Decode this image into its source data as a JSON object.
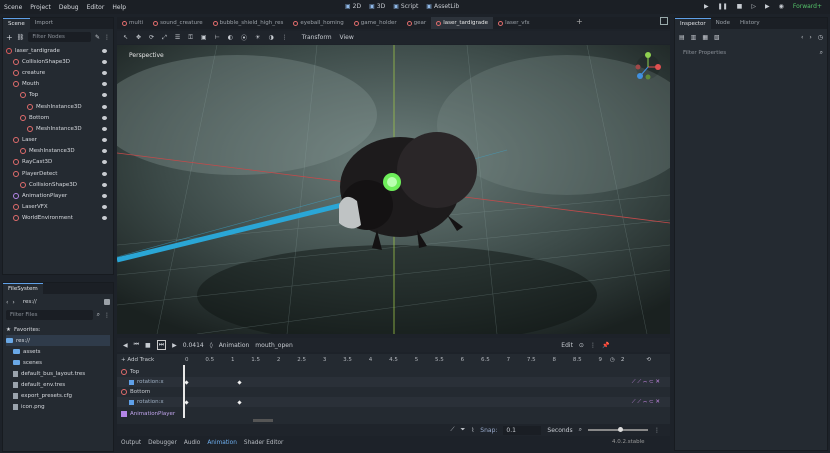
{
  "menu": [
    "Scene",
    "Project",
    "Debug",
    "Editor",
    "Help"
  ],
  "workspaces": [
    "2D",
    "3D",
    "Script",
    "AssetLib"
  ],
  "renderer": "Forward+",
  "doc_tabs": [
    "multi",
    "sound_creature",
    "bubble_shield_high_res",
    "eyeball_homing",
    "game_holder",
    "gear",
    "laser_tardigrade",
    "laser_vfx"
  ],
  "active_doc": "laser_tardigrade",
  "scene_dock": {
    "tabs": [
      "Scene",
      "Import"
    ],
    "filter_placeholder": "Filter Nodes",
    "nodes": [
      {
        "label": "laser_tardigrade",
        "indent": 0,
        "color": "#e05c5c"
      },
      {
        "label": "CollisionShape3D",
        "indent": 1,
        "color": "#e06c6c"
      },
      {
        "label": "creature",
        "indent": 1,
        "color": "#e06c6c"
      },
      {
        "label": "Mouth",
        "indent": 1,
        "color": "#e06c6c"
      },
      {
        "label": "Top",
        "indent": 2,
        "color": "#e06c6c"
      },
      {
        "label": "MeshInstance3D",
        "indent": 3,
        "color": "#e06c6c"
      },
      {
        "label": "Bottom",
        "indent": 2,
        "color": "#e06c6c"
      },
      {
        "label": "MeshInstance3D",
        "indent": 3,
        "color": "#e06c6c"
      },
      {
        "label": "Laser",
        "indent": 1,
        "color": "#e06c6c"
      },
      {
        "label": "MeshInstance3D",
        "indent": 2,
        "color": "#e06c6c"
      },
      {
        "label": "RayCast3D",
        "indent": 1,
        "color": "#e06c6c"
      },
      {
        "label": "PlayerDetect",
        "indent": 1,
        "color": "#e06c6c"
      },
      {
        "label": "CollisionShape3D",
        "indent": 2,
        "color": "#e06c6c"
      },
      {
        "label": "AnimationPlayer",
        "indent": 1,
        "color": "#b486e8"
      },
      {
        "label": "LaserVFX",
        "indent": 1,
        "color": "#e06c6c"
      },
      {
        "label": "WorldEnvironment",
        "indent": 1,
        "color": "#e06c6c"
      }
    ]
  },
  "filesystem": {
    "title": "FileSystem",
    "path": "res://",
    "filter_placeholder": "Filter Files",
    "favorites": "Favorites:",
    "items": [
      {
        "label": "res://",
        "type": "folder",
        "indent": 0
      },
      {
        "label": "assets",
        "type": "folder",
        "indent": 1
      },
      {
        "label": "scenes",
        "type": "folder",
        "indent": 1
      },
      {
        "label": "default_bus_layout.tres",
        "type": "file",
        "indent": 1
      },
      {
        "label": "default_env.tres",
        "type": "file",
        "indent": 1
      },
      {
        "label": "export_presets.cfg",
        "type": "file",
        "indent": 1
      },
      {
        "label": "icon.png",
        "type": "file",
        "indent": 1
      }
    ]
  },
  "viewport": {
    "label": "Perspective",
    "menus": [
      "Transform",
      "View"
    ]
  },
  "inspector": {
    "tabs": [
      "Inspector",
      "Node",
      "History"
    ],
    "filter_placeholder": "Filter Properties"
  },
  "animation": {
    "time": "0.0414",
    "label": "Animation",
    "name": "mouth_open",
    "edit": "Edit",
    "add_track": "Add Track",
    "ticks": [
      "0",
      "0.5",
      "1",
      "1.5",
      "2",
      "2.5",
      "3",
      "3.5",
      "4",
      "4.5",
      "5",
      "5.5",
      "6",
      "6.5",
      "7",
      "7.5",
      "8",
      "8.5",
      "9"
    ],
    "zoom": "2",
    "tracks": [
      {
        "group": "Top",
        "prop": "rotation:x"
      },
      {
        "group": "Bottom",
        "prop": "rotation:x"
      }
    ],
    "footer_group": "AnimationPlayer",
    "snap_label": "Snap:",
    "snap_value": "0.1",
    "snap_unit": "Seconds"
  },
  "bottom_tabs": [
    "Output",
    "Debugger",
    "Audio",
    "Animation",
    "Shader Editor"
  ],
  "version": "4.0.2.stable"
}
